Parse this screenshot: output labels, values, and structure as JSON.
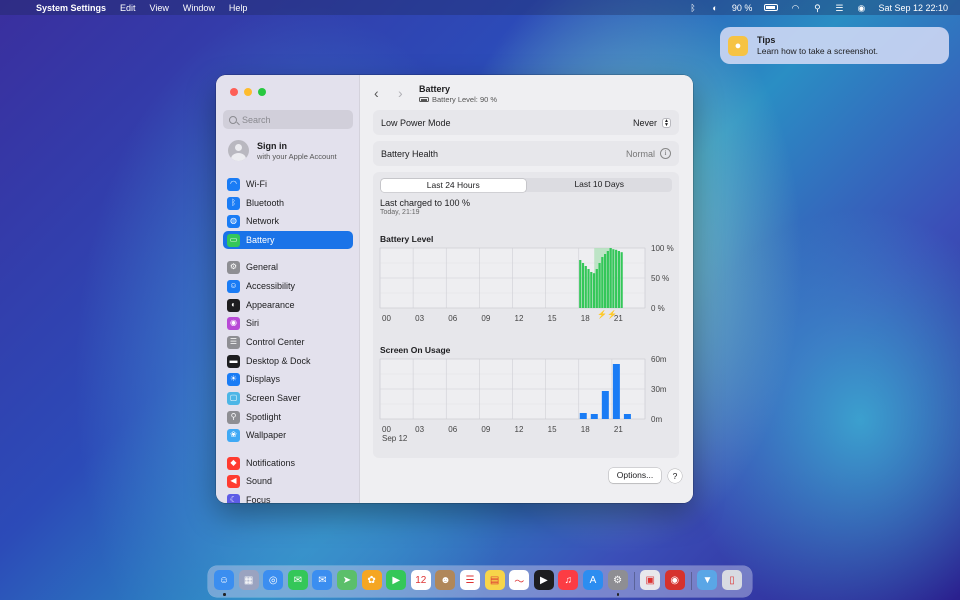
{
  "menubar": {
    "app_name": "System Settings",
    "menus": [
      "Edit",
      "View",
      "Window",
      "Help"
    ],
    "battery_percent": "90 %",
    "datetime": "Sat Sep 12  22:10"
  },
  "notification": {
    "title": "Tips",
    "body": "Learn how to take a screenshot.",
    "icon": "lightbulb-icon"
  },
  "sidebar": {
    "search_placeholder": "Search",
    "account": {
      "title": "Sign in",
      "subtitle": "with your Apple Account"
    },
    "items": [
      {
        "label": "Wi-Fi",
        "icon": "wifi-icon",
        "color": "#1a7cf5"
      },
      {
        "label": "Bluetooth",
        "icon": "bluetooth-icon",
        "color": "#1a7cf5"
      },
      {
        "label": "Network",
        "icon": "globe-icon",
        "color": "#1a7cf5"
      },
      {
        "label": "Battery",
        "icon": "battery-icon",
        "color": "#34c759",
        "selected": true
      },
      {
        "label": "General",
        "icon": "gear-icon",
        "color": "#8e8e93"
      },
      {
        "label": "Accessibility",
        "icon": "accessibility-icon",
        "color": "#1a7cf5"
      },
      {
        "label": "Appearance",
        "icon": "appearance-icon",
        "color": "#1d1d1f"
      },
      {
        "label": "Siri",
        "icon": "siri-icon",
        "color": "#b84ad6"
      },
      {
        "label": "Control Center",
        "icon": "control-center-icon",
        "color": "#8e8e93"
      },
      {
        "label": "Desktop & Dock",
        "icon": "dock-icon",
        "color": "#1d1d1f"
      },
      {
        "label": "Displays",
        "icon": "sun-icon",
        "color": "#1a7cf5"
      },
      {
        "label": "Screen Saver",
        "icon": "screen-saver-icon",
        "color": "#4db6e6"
      },
      {
        "label": "Spotlight",
        "icon": "spotlight-icon",
        "color": "#8e8e93"
      },
      {
        "label": "Wallpaper",
        "icon": "wallpaper-icon",
        "color": "#3fa9f5"
      },
      {
        "label": "Notifications",
        "icon": "bell-icon",
        "color": "#ff3b30"
      },
      {
        "label": "Sound",
        "icon": "speaker-icon",
        "color": "#ff3b30"
      },
      {
        "label": "Focus",
        "icon": "moon-icon",
        "color": "#5e5ce6"
      }
    ]
  },
  "main": {
    "title": "Battery",
    "subtitle": "Battery Level: 90 %",
    "low_power": {
      "label": "Low Power Mode",
      "value": "Never"
    },
    "health": {
      "label": "Battery Health",
      "value": "Normal"
    },
    "tabs": [
      {
        "label": "Last 24 Hours",
        "active": true
      },
      {
        "label": "Last 10 Days",
        "active": false
      }
    ],
    "last_charged": "Last charged to 100 %",
    "last_charged_time": "Today, 21:19",
    "date_label": "Sep 12",
    "options_label": "Options...",
    "help_label": "?"
  },
  "chart_data": [
    {
      "type": "bar",
      "title": "Battery Level",
      "categories": [
        "00",
        "03",
        "06",
        "09",
        "12",
        "15",
        "18",
        "21"
      ],
      "yticks": [
        "100 %",
        "50 %",
        "0 %"
      ],
      "ylim": [
        0,
        100
      ],
      "hours": [
        18.0,
        18.25,
        18.5,
        18.75,
        19.0,
        19.25,
        19.5,
        19.75,
        20.0,
        20.25,
        20.5,
        20.75,
        21.0,
        21.25,
        21.5,
        21.75
      ],
      "values": [
        80,
        75,
        70,
        65,
        60,
        58,
        65,
        75,
        85,
        90,
        95,
        100,
        98,
        97,
        95,
        93
      ],
      "charging_window": [
        19.4,
        21.0
      ],
      "color": "#34c759"
    },
    {
      "type": "bar",
      "title": "Screen On Usage",
      "categories": [
        "00",
        "03",
        "06",
        "09",
        "12",
        "15",
        "18",
        "21"
      ],
      "yticks": [
        "60m",
        "30m",
        "0m"
      ],
      "ylim": [
        0,
        60
      ],
      "hours": [
        18,
        19,
        20,
        21,
        22
      ],
      "values": [
        6,
        5,
        28,
        55,
        5
      ],
      "color": "#1a7cf5"
    }
  ],
  "dock": {
    "apps": [
      {
        "name": "finder-icon",
        "color": "#3b8ef0",
        "running": true
      },
      {
        "name": "launchpad-icon",
        "color": "#9aa3c0",
        "running": false
      },
      {
        "name": "safari-icon",
        "color": "#3b8ef0",
        "running": false
      },
      {
        "name": "messages-icon",
        "color": "#34c759",
        "running": false
      },
      {
        "name": "mail-icon",
        "color": "#3b8ef0",
        "running": false
      },
      {
        "name": "maps-icon",
        "color": "#5bbf6a",
        "running": false
      },
      {
        "name": "photos-icon",
        "color": "#f5a623",
        "running": false
      },
      {
        "name": "facetime-icon",
        "color": "#34c759",
        "running": false
      },
      {
        "name": "calendar-icon",
        "color": "#ffffff",
        "running": false
      },
      {
        "name": "contacts-icon",
        "color": "#b0875a",
        "running": false
      },
      {
        "name": "reminders-icon",
        "color": "#ffffff",
        "running": false
      },
      {
        "name": "notes-icon",
        "color": "#f7d54a",
        "running": false
      },
      {
        "name": "freeform-icon",
        "color": "#ffffff",
        "running": false
      },
      {
        "name": "tv-icon",
        "color": "#1d1d1f",
        "running": false
      },
      {
        "name": "music-icon",
        "color": "#fc3c44",
        "running": false
      },
      {
        "name": "app-store-icon",
        "color": "#2c8df0",
        "running": false
      },
      {
        "name": "system-settings-icon",
        "color": "#8e8e93",
        "running": true
      },
      {
        "name": "preview-icon",
        "color": "#e8e8ec",
        "running": false
      },
      {
        "name": "photo-booth-icon",
        "color": "#d6322d",
        "running": false
      },
      {
        "name": "downloads-icon",
        "color": "#5aa6e6",
        "running": false
      },
      {
        "name": "trash-icon",
        "color": "#d8dbe2",
        "running": false
      }
    ]
  }
}
